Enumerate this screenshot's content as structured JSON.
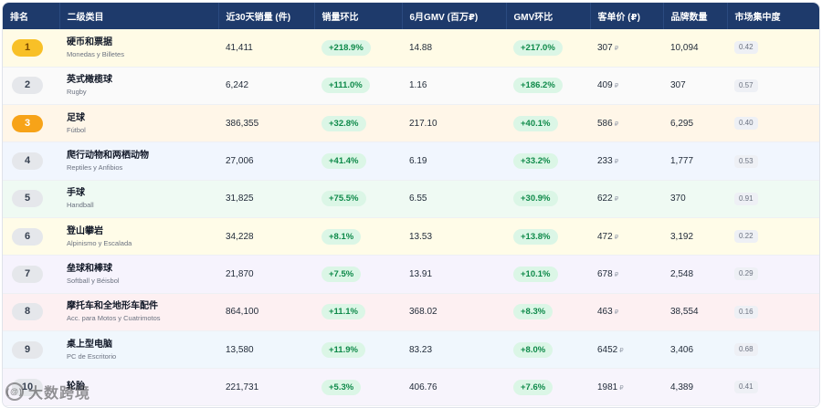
{
  "headers": [
    "排名",
    "二级类目",
    "近30天销量 (件)",
    "销量环比",
    "6月GMV (百万₽)",
    "GMV环比",
    "客单价 (₽)",
    "品牌数量",
    "市场集中度"
  ],
  "currency_symbol": "₽",
  "rows": [
    {
      "rank": "1",
      "name": "硬币和票据",
      "sub": "Monedas y Billetes",
      "sales": "41,411",
      "sales_change": "+218.9%",
      "gmv": "14.88",
      "gmv_change": "+217.0%",
      "aov": "307",
      "brands": "10,094",
      "concentration": "0.42",
      "bg": "#fffbe6",
      "rank_style": "gold"
    },
    {
      "rank": "2",
      "name": "英式橄榄球",
      "sub": "Rugby",
      "sales": "6,242",
      "sales_change": "+111.0%",
      "gmv": "1.16",
      "gmv_change": "+186.2%",
      "aov": "409",
      "brands": "307",
      "concentration": "0.57",
      "bg": "#fafafa",
      "rank_style": "gray"
    },
    {
      "rank": "3",
      "name": "足球",
      "sub": "Fútbol",
      "sales": "386,355",
      "sales_change": "+32.8%",
      "gmv": "217.10",
      "gmv_change": "+40.1%",
      "aov": "586",
      "brands": "6,295",
      "concentration": "0.40",
      "bg": "#fff6e8",
      "rank_style": "orange"
    },
    {
      "rank": "4",
      "name": "爬行动物和两栖动物",
      "sub": "Reptiles y Anfibios",
      "sales": "27,006",
      "sales_change": "+41.4%",
      "gmv": "6.19",
      "gmv_change": "+33.2%",
      "aov": "233",
      "brands": "1,777",
      "concentration": "0.53",
      "bg": "#f1f6fe",
      "rank_style": "gray"
    },
    {
      "rank": "5",
      "name": "手球",
      "sub": "Handball",
      "sales": "31,825",
      "sales_change": "+75.5%",
      "gmv": "6.55",
      "gmv_change": "+30.9%",
      "aov": "622",
      "brands": "370",
      "concentration": "0.91",
      "bg": "#effaf3",
      "rank_style": "gray"
    },
    {
      "rank": "6",
      "name": "登山攀岩",
      "sub": "Alpinismo y Escalada",
      "sales": "34,228",
      "sales_change": "+8.1%",
      "gmv": "13.53",
      "gmv_change": "+13.8%",
      "aov": "472",
      "brands": "3,192",
      "concentration": "0.22",
      "bg": "#fffce8",
      "rank_style": "gray"
    },
    {
      "rank": "7",
      "name": "垒球和棒球",
      "sub": "Softball y Béisbol",
      "sales": "21,870",
      "sales_change": "+7.5%",
      "gmv": "13.91",
      "gmv_change": "+10.1%",
      "aov": "678",
      "brands": "2,548",
      "concentration": "0.29",
      "bg": "#f6f3fd",
      "rank_style": "gray"
    },
    {
      "rank": "8",
      "name": "摩托车和全地形车配件",
      "sub": "Acc. para Motos y Cuatrimotos",
      "sales": "864,100",
      "sales_change": "+11.1%",
      "gmv": "368.02",
      "gmv_change": "+8.3%",
      "aov": "463",
      "brands": "38,554",
      "concentration": "0.16",
      "bg": "#fdf0f2",
      "rank_style": "gray"
    },
    {
      "rank": "9",
      "name": "桌上型电脑",
      "sub": "PC de Escritorio",
      "sales": "13,580",
      "sales_change": "+11.9%",
      "gmv": "83.23",
      "gmv_change": "+8.0%",
      "aov": "6452",
      "brands": "3,406",
      "concentration": "0.68",
      "bg": "#f0f7fd",
      "rank_style": "gray"
    },
    {
      "rank": "10",
      "name": "轮胎",
      "sub": "",
      "sales": "221,731",
      "sales_change": "+5.3%",
      "gmv": "406.76",
      "gmv_change": "+7.6%",
      "aov": "1981",
      "brands": "4,389",
      "concentration": "0.41",
      "bg": "#f7f4fc",
      "rank_style": "gray"
    }
  ],
  "watermark": {
    "text": "大数跨境",
    "logo": "(@)"
  }
}
